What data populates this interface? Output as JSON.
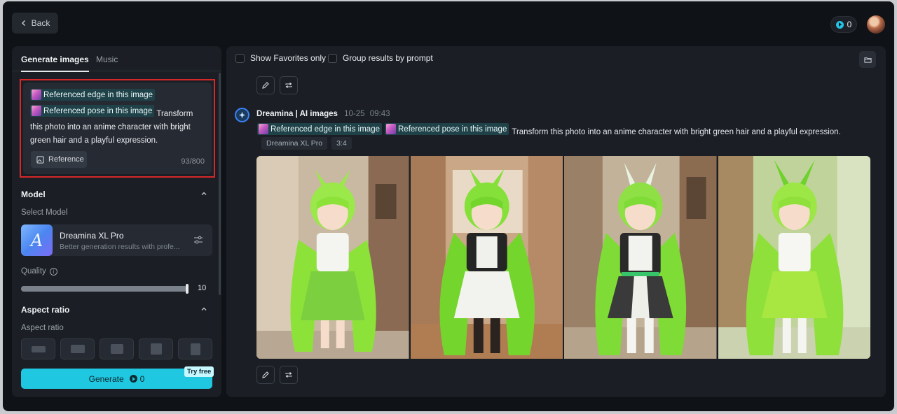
{
  "header": {
    "back_label": "Back",
    "credits": "0"
  },
  "left_panel": {
    "tabs": [
      {
        "label": "Generate images",
        "active": true
      },
      {
        "label": "Music",
        "active": false
      }
    ],
    "prompt": {
      "chip_edge": "Referenced edge in this image",
      "chip_pose": "Referenced pose in this image",
      "text": "Transform this photo into an anime character with bright green hair and a playful expression.",
      "reference_label": "Reference",
      "counter": "93/800"
    },
    "model_section": {
      "title": "Model",
      "select_label": "Select Model",
      "model_name": "Dreamina XL Pro",
      "model_desc": "Better generation results with profe...",
      "thumb_letter": "A"
    },
    "quality": {
      "label": "Quality",
      "value": "10"
    },
    "aspect_section": {
      "title": "Aspect ratio",
      "label": "Aspect ratio"
    },
    "generate": {
      "label": "Generate",
      "cost": "0",
      "badge": "Try free"
    }
  },
  "right_panel": {
    "show_favorites_label": "Show Favorites only",
    "group_by_prompt_label": "Group results by prompt",
    "message": {
      "sender": "Dreamina | AI images",
      "date": "10-25",
      "time": "09:43",
      "chip_edge": "Referenced edge in this image",
      "chip_pose": "Referenced pose in this image",
      "text": "Transform this photo into an anime character with bright green hair and a playful expression.",
      "tags": [
        "Dreamina XL Pro",
        "3:4"
      ]
    }
  },
  "colors": {
    "accent": "#1fc7e0",
    "highlight_border": "#d62828",
    "chip_bg": "#1f4148",
    "hair_green": "#7ddc2e"
  }
}
